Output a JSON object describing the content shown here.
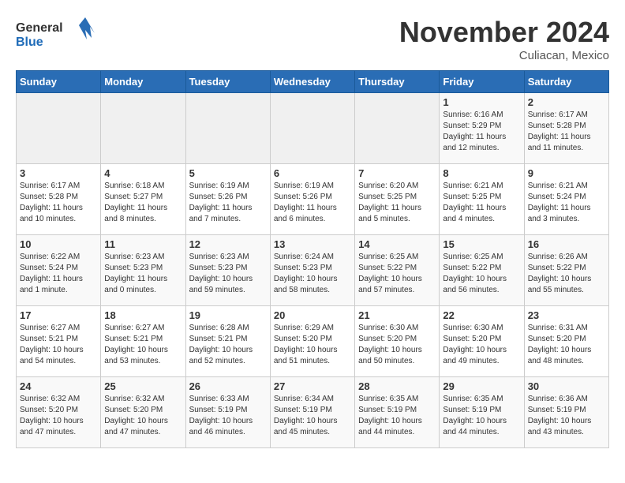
{
  "header": {
    "logo_general": "General",
    "logo_blue": "Blue",
    "month_title": "November 2024",
    "subtitle": "Culiacan, Mexico"
  },
  "days_of_week": [
    "Sunday",
    "Monday",
    "Tuesday",
    "Wednesday",
    "Thursday",
    "Friday",
    "Saturday"
  ],
  "weeks": [
    [
      {
        "day": "",
        "info": ""
      },
      {
        "day": "",
        "info": ""
      },
      {
        "day": "",
        "info": ""
      },
      {
        "day": "",
        "info": ""
      },
      {
        "day": "",
        "info": ""
      },
      {
        "day": "1",
        "info": "Sunrise: 6:16 AM\nSunset: 5:29 PM\nDaylight: 11 hours\nand 12 minutes."
      },
      {
        "day": "2",
        "info": "Sunrise: 6:17 AM\nSunset: 5:28 PM\nDaylight: 11 hours\nand 11 minutes."
      }
    ],
    [
      {
        "day": "3",
        "info": "Sunrise: 6:17 AM\nSunset: 5:28 PM\nDaylight: 11 hours\nand 10 minutes."
      },
      {
        "day": "4",
        "info": "Sunrise: 6:18 AM\nSunset: 5:27 PM\nDaylight: 11 hours\nand 8 minutes."
      },
      {
        "day": "5",
        "info": "Sunrise: 6:19 AM\nSunset: 5:26 PM\nDaylight: 11 hours\nand 7 minutes."
      },
      {
        "day": "6",
        "info": "Sunrise: 6:19 AM\nSunset: 5:26 PM\nDaylight: 11 hours\nand 6 minutes."
      },
      {
        "day": "7",
        "info": "Sunrise: 6:20 AM\nSunset: 5:25 PM\nDaylight: 11 hours\nand 5 minutes."
      },
      {
        "day": "8",
        "info": "Sunrise: 6:21 AM\nSunset: 5:25 PM\nDaylight: 11 hours\nand 4 minutes."
      },
      {
        "day": "9",
        "info": "Sunrise: 6:21 AM\nSunset: 5:24 PM\nDaylight: 11 hours\nand 3 minutes."
      }
    ],
    [
      {
        "day": "10",
        "info": "Sunrise: 6:22 AM\nSunset: 5:24 PM\nDaylight: 11 hours\nand 1 minute."
      },
      {
        "day": "11",
        "info": "Sunrise: 6:23 AM\nSunset: 5:23 PM\nDaylight: 11 hours\nand 0 minutes."
      },
      {
        "day": "12",
        "info": "Sunrise: 6:23 AM\nSunset: 5:23 PM\nDaylight: 10 hours\nand 59 minutes."
      },
      {
        "day": "13",
        "info": "Sunrise: 6:24 AM\nSunset: 5:23 PM\nDaylight: 10 hours\nand 58 minutes."
      },
      {
        "day": "14",
        "info": "Sunrise: 6:25 AM\nSunset: 5:22 PM\nDaylight: 10 hours\nand 57 minutes."
      },
      {
        "day": "15",
        "info": "Sunrise: 6:25 AM\nSunset: 5:22 PM\nDaylight: 10 hours\nand 56 minutes."
      },
      {
        "day": "16",
        "info": "Sunrise: 6:26 AM\nSunset: 5:22 PM\nDaylight: 10 hours\nand 55 minutes."
      }
    ],
    [
      {
        "day": "17",
        "info": "Sunrise: 6:27 AM\nSunset: 5:21 PM\nDaylight: 10 hours\nand 54 minutes."
      },
      {
        "day": "18",
        "info": "Sunrise: 6:27 AM\nSunset: 5:21 PM\nDaylight: 10 hours\nand 53 minutes."
      },
      {
        "day": "19",
        "info": "Sunrise: 6:28 AM\nSunset: 5:21 PM\nDaylight: 10 hours\nand 52 minutes."
      },
      {
        "day": "20",
        "info": "Sunrise: 6:29 AM\nSunset: 5:20 PM\nDaylight: 10 hours\nand 51 minutes."
      },
      {
        "day": "21",
        "info": "Sunrise: 6:30 AM\nSunset: 5:20 PM\nDaylight: 10 hours\nand 50 minutes."
      },
      {
        "day": "22",
        "info": "Sunrise: 6:30 AM\nSunset: 5:20 PM\nDaylight: 10 hours\nand 49 minutes."
      },
      {
        "day": "23",
        "info": "Sunrise: 6:31 AM\nSunset: 5:20 PM\nDaylight: 10 hours\nand 48 minutes."
      }
    ],
    [
      {
        "day": "24",
        "info": "Sunrise: 6:32 AM\nSunset: 5:20 PM\nDaylight: 10 hours\nand 47 minutes."
      },
      {
        "day": "25",
        "info": "Sunrise: 6:32 AM\nSunset: 5:20 PM\nDaylight: 10 hours\nand 47 minutes."
      },
      {
        "day": "26",
        "info": "Sunrise: 6:33 AM\nSunset: 5:19 PM\nDaylight: 10 hours\nand 46 minutes."
      },
      {
        "day": "27",
        "info": "Sunrise: 6:34 AM\nSunset: 5:19 PM\nDaylight: 10 hours\nand 45 minutes."
      },
      {
        "day": "28",
        "info": "Sunrise: 6:35 AM\nSunset: 5:19 PM\nDaylight: 10 hours\nand 44 minutes."
      },
      {
        "day": "29",
        "info": "Sunrise: 6:35 AM\nSunset: 5:19 PM\nDaylight: 10 hours\nand 44 minutes."
      },
      {
        "day": "30",
        "info": "Sunrise: 6:36 AM\nSunset: 5:19 PM\nDaylight: 10 hours\nand 43 minutes."
      }
    ]
  ]
}
